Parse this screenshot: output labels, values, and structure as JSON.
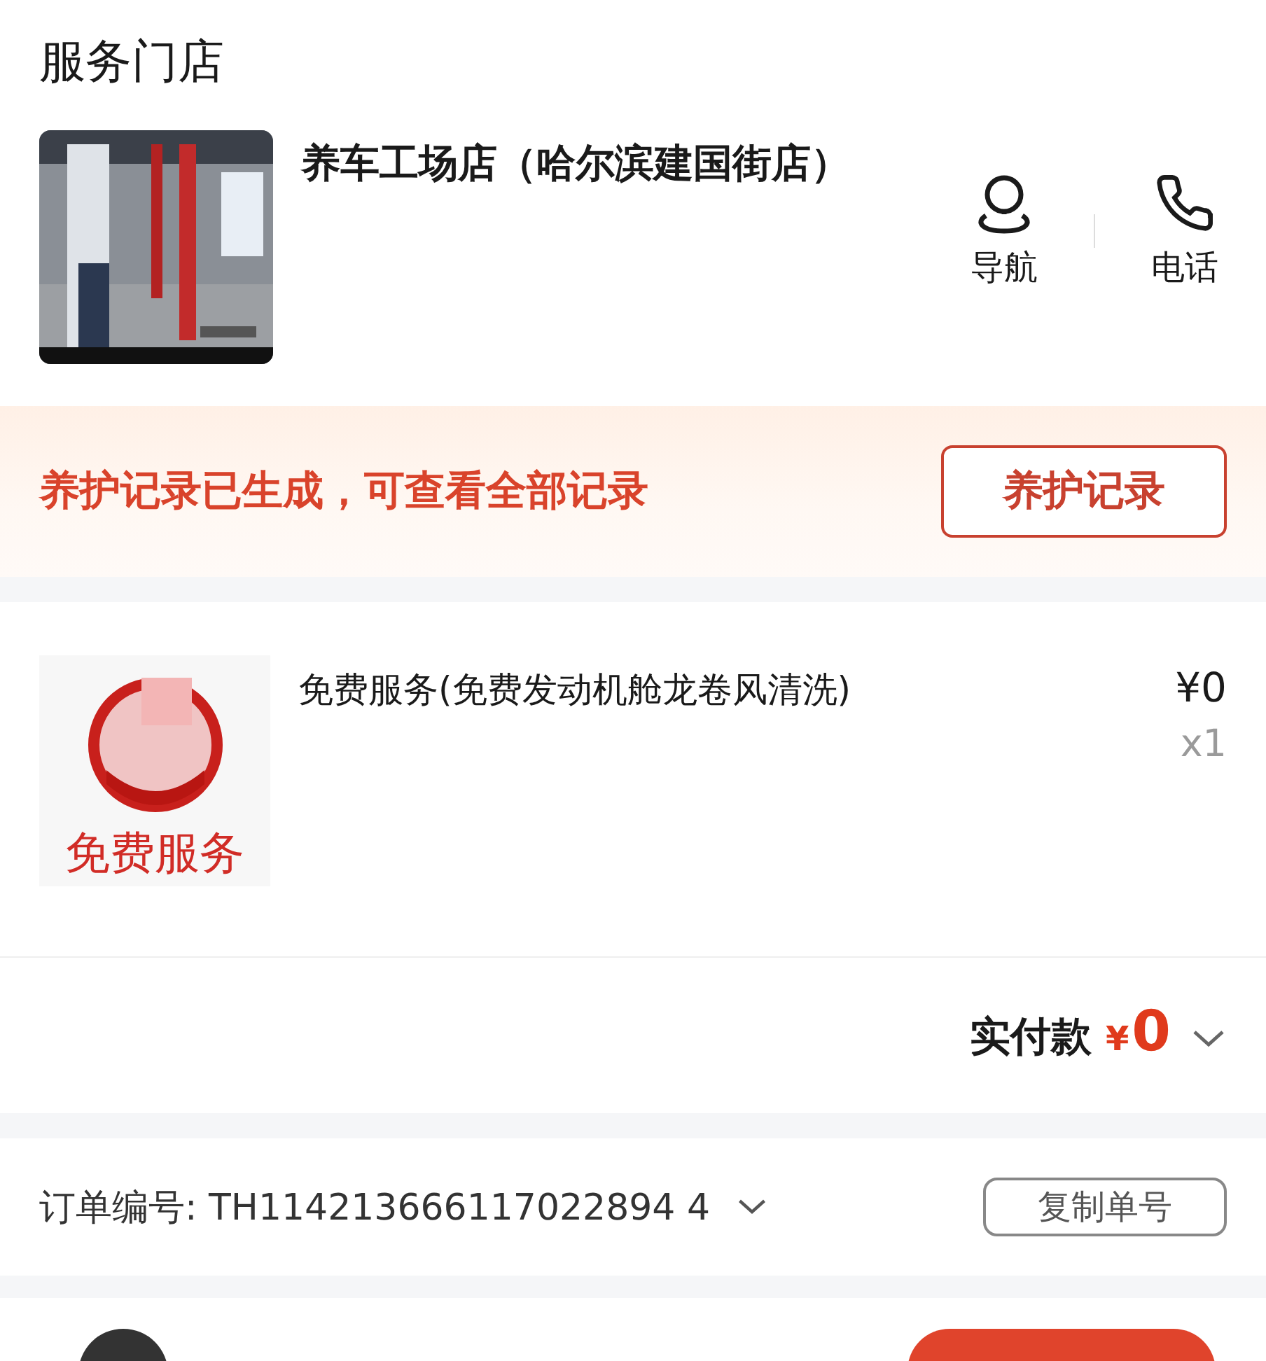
{
  "store_section": {
    "title": "服务门店",
    "store_name": "养车工场店（哈尔滨建国街店）",
    "actions": [
      {
        "kind": "navigate",
        "label": "导航"
      },
      {
        "kind": "phone",
        "label": "电话"
      }
    ]
  },
  "notice": {
    "text": "养护记录已生成，可查看全部记录",
    "button": "养护记录"
  },
  "items": [
    {
      "name": "免费服务(免费发动机舱龙卷风清洗)",
      "image_caption": "免费服务",
      "price": "¥0",
      "quantity": "x1"
    }
  ],
  "payment": {
    "label": "实付款",
    "currency": "¥",
    "amount": "0",
    "expanded": false
  },
  "order": {
    "label": "订单编号:",
    "number": "TH114213666117022894 4",
    "button": "复制单号"
  }
}
